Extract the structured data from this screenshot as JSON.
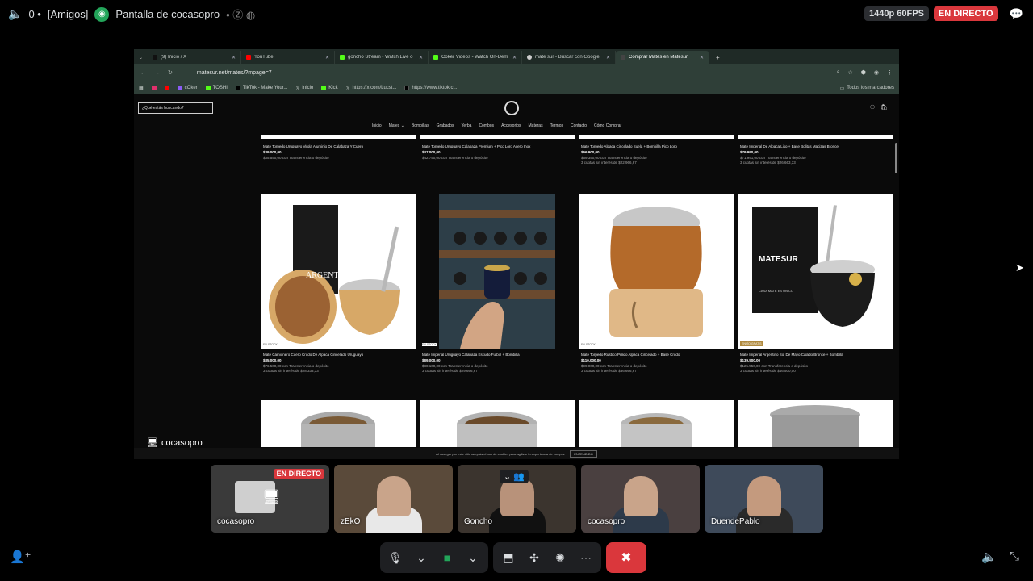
{
  "topbar": {
    "channel_label": "[Amigos]",
    "channel_prefix": "0 •",
    "stream_title": "Pantalla de cocasopro",
    "quality": "1440p 60FPS",
    "live": "EN DIRECTO"
  },
  "browser": {
    "tabs": [
      {
        "label": "(9) Inicio / X",
        "color": "#111111"
      },
      {
        "label": "YouTube",
        "color": "#ff0000"
      },
      {
        "label": "goncho Stream - Watch Live o",
        "color": "#53fc18"
      },
      {
        "label": "Coker Videos - Watch On-Dem",
        "color": "#53fc18"
      },
      {
        "label": "mate sur - Buscar con Google",
        "color": "#cccccc"
      },
      {
        "label": "Comprar Mates en Matesur",
        "color": "#444444"
      }
    ],
    "url": "matesur.net/mates/?mpage=7",
    "bookmarks": [
      "cOker",
      "TOSHI",
      "TikTok - Make Your...",
      "Inicio",
      "Kick",
      "https://x.com/Lucst...",
      "https://www.tiktok.c..."
    ],
    "all_bookmarks": "Todos los marcadores"
  },
  "site": {
    "search_placeholder": "¿Qué estás buscando?",
    "nav": [
      "Inicio",
      "Mates ⌄",
      "Bombillas",
      "Grabados",
      "Yerba",
      "Combos",
      "Accesorios",
      "Materas",
      "Termos",
      "Contacto",
      "Cómo Comprar"
    ],
    "top_row": [
      {
        "name": "Mate Torpedo Uruguayo Virola Aluminio De Calabaza Y Cuero",
        "price": "$39.000,00",
        "sub": "$35.550,00 con Transferencia o depósito",
        "extra": ""
      },
      {
        "name": "Mate Torpedo Uruguayo Calabaza Premium + Pico Loro Acero Inox",
        "price": "$47.000,00",
        "sub": "$42.750,00 con Transferencia o depósito",
        "extra": ""
      },
      {
        "name": "Mate Torpedo Alpaca Cincelado Suela + Bombilla Pico Loro",
        "price": "$66.900,00",
        "sub": "$59.350,00 con Transferencia o depósito",
        "extra": "3 cuotas sin interés de $22.966,67"
      },
      {
        "name": "Mate Imperial De Alpaca Liso + Base Bolitas Macizas Bronce",
        "price": "$79.990,00",
        "sub": "$71.991,00 con Transferencia o depósito",
        "extra": "3 cuotas sin interés de $26.663,33"
      }
    ],
    "products": [
      {
        "name": "Mate Camionero Cuero Crudo De Alpaca Cincelado Uruguayo",
        "price": "$85.000,00",
        "sub": "$76.500,00 con Transferencia o depósito",
        "extra": "3 cuotas sin interés de $28.333,33",
        "stock": "EN STOCK"
      },
      {
        "name": "Mate Imperial Uruguayo Calabaza Escudo Futbol + Bombilla",
        "price": "$89.000,00",
        "sub": "$80.100,00 con Transferencia o depósito",
        "extra": "3 cuotas sin interés de $29.666,67",
        "stock": "EN STOCK"
      },
      {
        "name": "Mate Torpedo Rustico Pulido Alpaca Cincelado + Base Crudo",
        "price": "$110.000,00",
        "sub": "$99.000,00 con Transferencia o depósito",
        "extra": "3 cuotas sin interés de $36.666,67",
        "stock": "EN STOCK"
      },
      {
        "name": "Mate Imperial Argentino Sol De Mayo Calado Bronce + Bombilla",
        "price": "$139.500,00",
        "sub": "$125.550,00 con Transferencia o depósito",
        "extra": "3 cuotas sin interés de $46.500,00",
        "stock": "ENVÍO GRATIS"
      }
    ],
    "product_image_texts": {
      "argentina": "ARGENTINA",
      "matesur": "MATESUR",
      "tagline": "CASA MATE ES ÚNICO"
    },
    "cookie_text": "Al navegar por este sitio aceptás el uso de cookies para agilizar tu experiencia de compra.",
    "cookie_button": "ENTENDIDO"
  },
  "streamer_tag": "cocasopro",
  "participants": [
    {
      "name": "cocasopro",
      "live": "EN DIRECTO",
      "bg": "#3a3a3a"
    },
    {
      "name": "zEkO",
      "live": "",
      "bg": "#5a4a3a"
    },
    {
      "name": "Goncho",
      "live": "",
      "bg": "#3b342e"
    },
    {
      "name": "cocasopro",
      "live": "",
      "bg": "#4a4040"
    },
    {
      "name": "DuendePablo",
      "live": "",
      "bg": "#3e4a5a"
    }
  ],
  "icons": {
    "mic": "microphone-icon",
    "camera": "camera-icon",
    "screen": "screen-share-icon",
    "activities": "activities-icon",
    "soundboard": "soundboard-icon",
    "more": "more-icon",
    "hangup": "hang-up-icon"
  }
}
